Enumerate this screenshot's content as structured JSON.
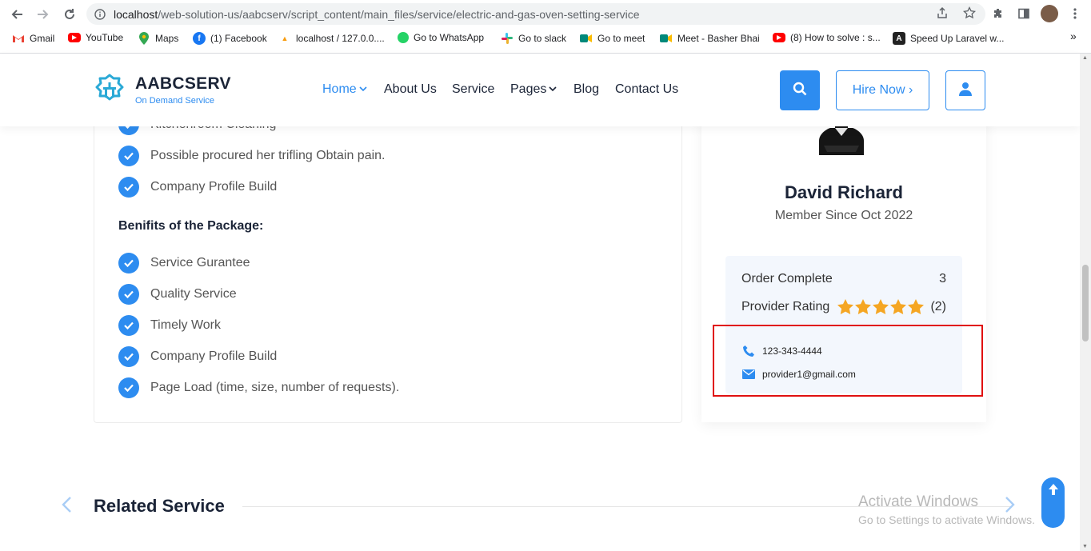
{
  "browser": {
    "url_host": "localhost",
    "url_path": "/web-solution-us/aabcserv/script_content/main_files/service/electric-and-gas-oven-setting-service",
    "bookmarks": [
      {
        "label": "Gmail",
        "icon": "gmail-icon",
        "color": "#ea4335"
      },
      {
        "label": "YouTube",
        "icon": "youtube-icon",
        "color": "#ff0000"
      },
      {
        "label": "Maps",
        "icon": "maps-icon",
        "color": "#34a853"
      },
      {
        "label": "(1) Facebook",
        "icon": "facebook-icon",
        "color": "#1877f2"
      },
      {
        "label": "localhost / 127.0.0....",
        "icon": "phpmyadmin-icon",
        "color": "#f89c0e"
      },
      {
        "label": "Go to WhatsApp",
        "icon": "whatsapp-icon",
        "color": "#25d366"
      },
      {
        "label": "Go to slack",
        "icon": "slack-icon",
        "color": "#611f69"
      },
      {
        "label": "Go to meet",
        "icon": "meet-icon",
        "color": "#00897b"
      },
      {
        "label": "Meet - Basher Bhai",
        "icon": "meet-icon",
        "color": "#00897b"
      },
      {
        "label": "(8) How to solve : s...",
        "icon": "youtube-icon",
        "color": "#ff0000"
      },
      {
        "label": "Speed Up Laravel w...",
        "icon": "laravel-icon",
        "color": "#c22a1e"
      }
    ],
    "more_bookmarks": "»"
  },
  "header": {
    "brand": "AABCSERV",
    "tagline": "On Demand Service",
    "nav": [
      {
        "label": "Home",
        "has_caret": true,
        "active": true
      },
      {
        "label": "About Us"
      },
      {
        "label": "Service"
      },
      {
        "label": "Pages",
        "has_caret": true
      },
      {
        "label": "Blog"
      },
      {
        "label": "Contact Us"
      }
    ],
    "hire_label": "Hire Now ›",
    "accent": "#2d8cf0"
  },
  "content": {
    "top_items": [
      "Kitchenroom Cleaning",
      "Possible procured her trifling Obtain pain.",
      "Company Profile Build"
    ],
    "benefits_title": "Benifits of the Package:",
    "benefits": [
      "Service Gurantee",
      "Quality Service",
      "Timely Work",
      "Company Profile Build",
      "Page Load (time, size, number of requests)."
    ]
  },
  "provider": {
    "name": "David Richard",
    "member_since": "Member Since Oct 2022",
    "order_complete_label": "Order Complete",
    "order_complete_value": "3",
    "rating_label": "Provider Rating",
    "rating_stars": 5,
    "rating_count": "(2)",
    "star_color": "#f5a623",
    "phone": "123-343-4444",
    "email": "provider1@gmail.com"
  },
  "related": {
    "title": "Related Service"
  },
  "watermark": {
    "line1": "Activate Windows",
    "line2": "Go to Settings to activate Windows."
  }
}
